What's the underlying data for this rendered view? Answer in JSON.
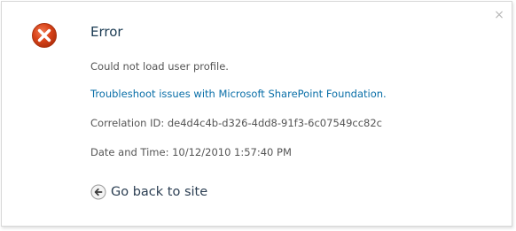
{
  "dialog": {
    "close_glyph": "×",
    "title": "Error",
    "message": "Could not load user profile.",
    "troubleshoot_link": "Troubleshoot issues with Microsoft SharePoint Foundation.",
    "correlation": "Correlation ID: de4d4c4b-d326-4dd8-91f3-6c07549cc82c",
    "datetime": "Date and Time: 10/12/2010 1:57:40 PM",
    "back_label": "Go back to site",
    "icons": {
      "error": "error-x-icon",
      "back": "back-arrow-icon",
      "close": "close-icon"
    }
  },
  "colors": {
    "error_red": "#d9441a",
    "link_blue": "#0a6fa8",
    "title_text": "#1a3a52"
  }
}
